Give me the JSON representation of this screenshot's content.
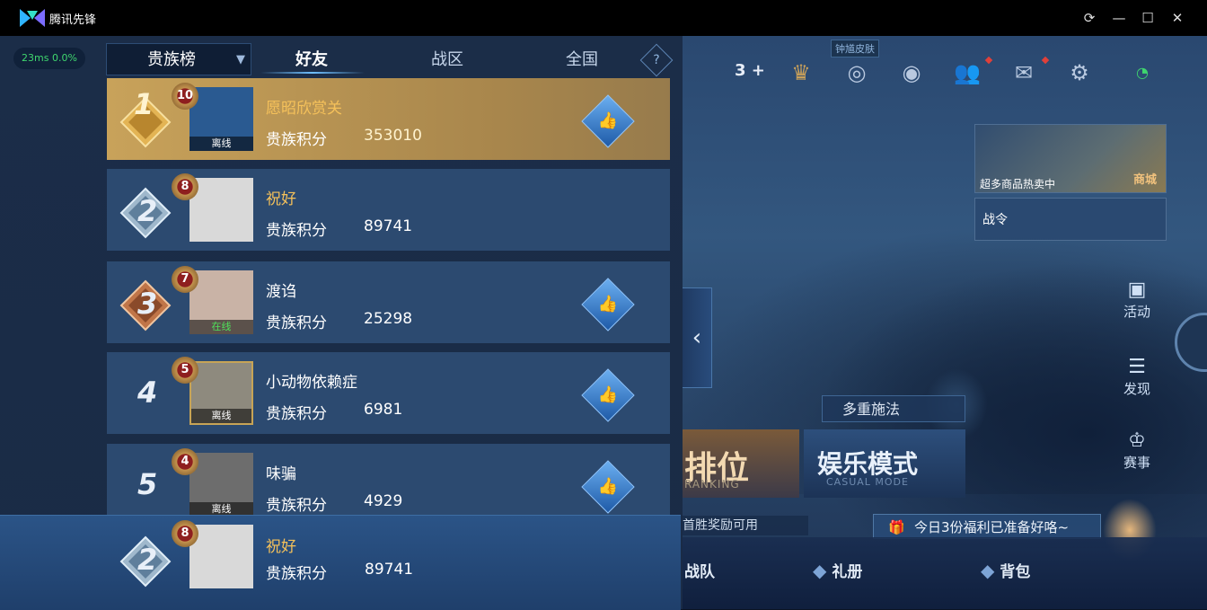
{
  "window": {
    "title": "腾讯先锋",
    "controls": [
      "refresh-icon",
      "minimize-icon",
      "maximize-icon",
      "close-icon"
    ]
  },
  "status": {
    "ping": "23ms  0.0%"
  },
  "leaderboard": {
    "dropdown_label": "贵族榜",
    "tabs": [
      {
        "label": "好友",
        "active": true
      },
      {
        "label": "战区",
        "active": false
      },
      {
        "label": "全国",
        "active": false
      }
    ],
    "help_label": "?",
    "rows": [
      {
        "rank": "1",
        "level": "10",
        "name": "愿昭欣赏关",
        "score_label": "贵族积分",
        "score": "353010",
        "status": "离线",
        "liked": true
      },
      {
        "rank": "2",
        "level": "8",
        "name": "祝好",
        "score_label": "贵族积分",
        "score": "89741",
        "status": "",
        "liked": false
      },
      {
        "rank": "3",
        "level": "7",
        "name": "渡诌",
        "score_label": "贵族积分",
        "score": "25298",
        "status": "在线",
        "liked": true
      },
      {
        "rank": "4",
        "level": "5",
        "name": "小动物依赖症",
        "score_label": "贵族积分",
        "score": "6981",
        "status": "离线",
        "liked": true
      },
      {
        "rank": "5",
        "level": "4",
        "name": "味骗",
        "score_label": "贵族积分",
        "score": "4929",
        "status": "离线",
        "liked": true
      }
    ],
    "self": {
      "rank": "2",
      "level": "8",
      "name": "祝好",
      "score_label": "贵族积分",
      "score": "89741"
    }
  },
  "game": {
    "topbar": {
      "count": "3",
      "skin_tag": "钟馗皮肤"
    },
    "shop": {
      "promo": "超多商品热卖中",
      "label": "商城"
    },
    "battle_pass": "战令",
    "side": [
      {
        "label": "活动"
      },
      {
        "label": "发现"
      },
      {
        "label": "赛事"
      }
    ],
    "multi_cast": "多重施法",
    "rank_mode": {
      "title": "排位",
      "subtitle": "RANKING"
    },
    "casual_mode": {
      "title": "娱乐模式",
      "subtitle": "CASUAL MODE"
    },
    "reward_strip": "首胜奖励可用",
    "welfare": "今日3份福利已准备好咯~",
    "bottom": [
      {
        "label": "战队"
      },
      {
        "label": "礼册"
      },
      {
        "label": "背包"
      }
    ]
  },
  "colors": {
    "gold_row": "#c8a25a",
    "row_bg": "#2c4a70",
    "online_green": "#4fe05a",
    "name_gold": "#f5c15a"
  }
}
